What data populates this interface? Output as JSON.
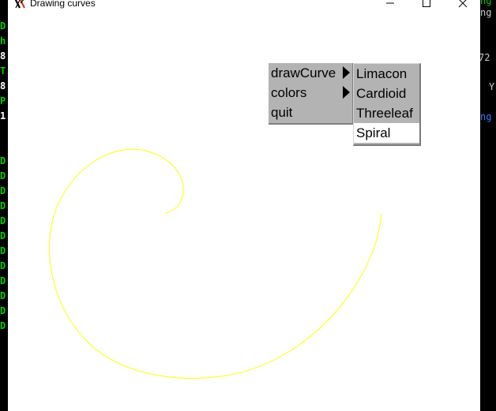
{
  "window": {
    "title": "Drawing curves",
    "controls": {
      "minimize": "minimize-icon",
      "maximize": "maximize-icon",
      "close": "close-icon"
    }
  },
  "background_terminal": {
    "left_chars": [
      "D",
      "h",
      "8",
      "T",
      "8",
      "P",
      "1",
      "D",
      "D",
      "D",
      "D",
      "D",
      "D",
      "D",
      "D",
      "D",
      "D",
      "D",
      "D"
    ],
    "right_fragments": [
      "ng",
      "ng",
      "72",
      "Y",
      "ng"
    ]
  },
  "menu": {
    "items": [
      {
        "label": "drawCurve",
        "has_submenu": true
      },
      {
        "label": "colors",
        "has_submenu": true
      },
      {
        "label": "quit",
        "has_submenu": false
      }
    ],
    "submenu": {
      "items": [
        {
          "label": "Limacon"
        },
        {
          "label": "Cardioid"
        },
        {
          "label": "Threeleaf"
        },
        {
          "label": "Spiral"
        }
      ],
      "highlighted": "Spiral"
    }
  },
  "curve": {
    "type": "Spiral",
    "color": "#ffff00"
  },
  "colors": {
    "terminal_green": "#00cc00",
    "terminal_white": "#ffffff",
    "terminal_blue": "#3b78ff",
    "menu_gray": "#b3b3b3"
  }
}
